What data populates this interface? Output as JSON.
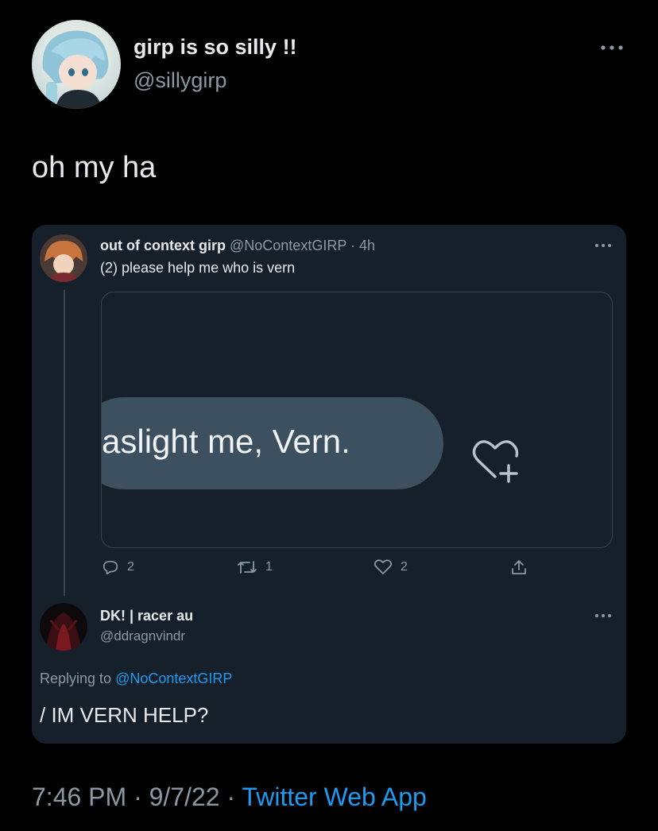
{
  "author": {
    "display_name": "girp is so silly !!",
    "handle": "@sillygirp"
  },
  "tweet": {
    "text": "oh my ha"
  },
  "quote": {
    "display_name": "out of context girp",
    "handle": "@NoContextGIRP",
    "separator": "·",
    "time": "4h",
    "text": "(2) please help me who is vern",
    "media": {
      "bubble_text": "aslight me, Vern."
    },
    "actions": {
      "replies": "2",
      "retweets": "1",
      "likes": "2"
    }
  },
  "reply": {
    "display_name": "DK! | racer au",
    "handle": "@ddragnvindr",
    "replying_prefix": "Replying to",
    "replying_to": "@NoContextGIRP",
    "text": "/ IM VERN HELP?"
  },
  "footer": {
    "time": "7:46 PM",
    "sep1": "·",
    "date": "9/7/22",
    "sep2": "·",
    "app": "Twitter Web App"
  },
  "colors": {
    "background": "#000000",
    "card": "#15202b",
    "link": "#1d9bf0",
    "muted": "#8b98a5"
  }
}
